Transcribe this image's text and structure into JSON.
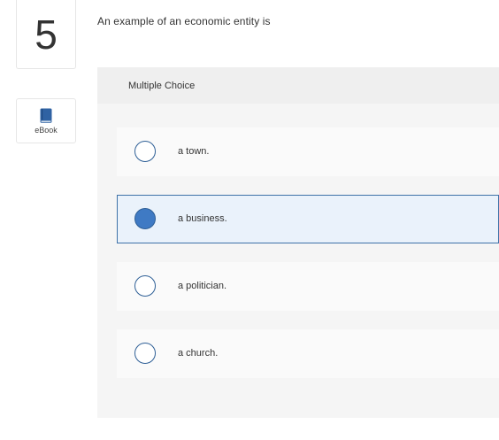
{
  "question": {
    "number": "5",
    "prompt": "An example of an economic entity is"
  },
  "ebook": {
    "label": "eBook",
    "icon": "book-icon"
  },
  "panel": {
    "title": "Multiple Choice"
  },
  "options": [
    {
      "label": "a town.",
      "selected": false
    },
    {
      "label": "a business.",
      "selected": true
    },
    {
      "label": "a politician.",
      "selected": false
    },
    {
      "label": "a church.",
      "selected": false
    }
  ],
  "colors": {
    "accent": "#3f7ac4",
    "selected_background": "#eaf2fb",
    "selected_border": "#3f72a8"
  }
}
